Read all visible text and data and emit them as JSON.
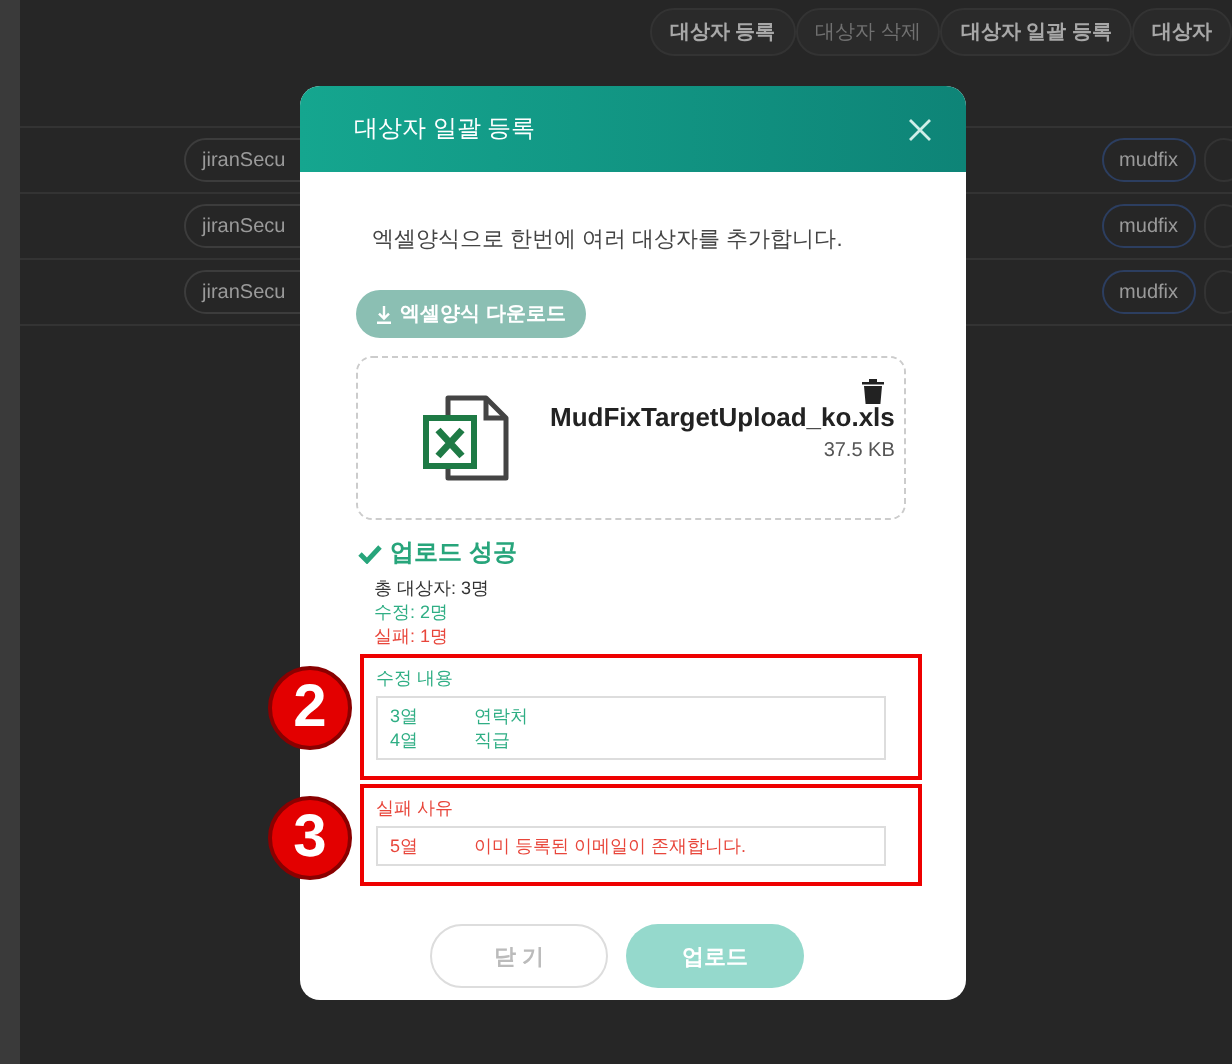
{
  "toolbar": [
    {
      "label": "대상자 등록",
      "disabled": false
    },
    {
      "label": "대상자 삭제",
      "disabled": true
    },
    {
      "label": "대상자 일괄 등록",
      "disabled": false
    },
    {
      "label": "대상자",
      "disabled": false
    }
  ],
  "rows": [
    {
      "name": "jiranSecu",
      "tag": "mudfix"
    },
    {
      "name": "jiranSecu",
      "tag": "mudfix"
    },
    {
      "name": "jiranSecu",
      "tag": "mudfix"
    }
  ],
  "dialog": {
    "title": "대상자 일괄 등록",
    "intro": "엑셀양식으로 한번에 여러 대상자를 추가합니다.",
    "download_button": "엑셀양식 다운로드",
    "file": {
      "name": "MudFixTargetUpload_ko.xls",
      "size": "37.5 KB"
    },
    "status": "업로드 성공",
    "summary": [
      {
        "text": "총 대상자: 3명",
        "kind": "total"
      },
      {
        "text": "수정: 2명",
        "kind": "modified"
      },
      {
        "text": "실패: 1명",
        "kind": "failed"
      }
    ],
    "sections": [
      {
        "kind": "modified",
        "label": "수정 내용",
        "callout": "2",
        "rows": [
          {
            "column": "3열",
            "text": "연락처"
          },
          {
            "column": "4열",
            "text": "직급"
          }
        ]
      },
      {
        "kind": "failed",
        "label": "실패 사유",
        "callout": "3",
        "rows": [
          {
            "column": "5열",
            "text": "이미 등록된 이메일이 존재합니다."
          }
        ]
      }
    ],
    "buttons": [
      {
        "label": "닫 기",
        "kind": "secondary"
      },
      {
        "label": "업로드",
        "kind": "primary"
      }
    ]
  }
}
